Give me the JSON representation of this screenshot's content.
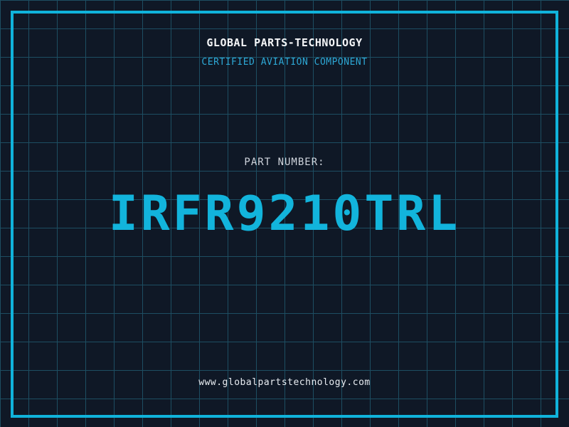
{
  "theme": {
    "background": "#0f1826",
    "grid": "#1d4e62",
    "frame": "#10b3db",
    "header-text": "#f5f6f8",
    "subheader-text": "#2da8d6",
    "label-text": "#cfd4dc",
    "part-number-text": "#12b4dc",
    "footer-text": "#e9edf2"
  },
  "header": {
    "title": "GLOBAL PARTS-TECHNOLOGY",
    "subtitle": "CERTIFIED AVIATION COMPONENT"
  },
  "part": {
    "label": "PART NUMBER:",
    "number": "IRFR9210TRL"
  },
  "footer": {
    "url": "www.globalpartstechnology.com"
  }
}
